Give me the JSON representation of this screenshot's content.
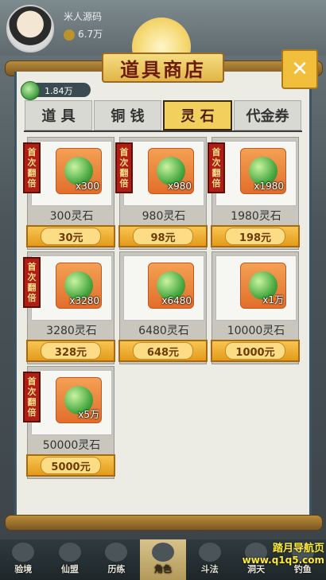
{
  "player": {
    "name": "米人源码",
    "coins": "6.7万"
  },
  "shop": {
    "title": "道具商店",
    "close_symbol": "✕"
  },
  "balance": {
    "gem_icon": "spirit-stone-icon",
    "value": "1.84万"
  },
  "tabs": [
    {
      "label": "道 具",
      "active": false
    },
    {
      "label": "铜 钱",
      "active": false
    },
    {
      "label": "灵 石",
      "active": true
    },
    {
      "label": "代金券",
      "active": false
    }
  ],
  "tag_text": [
    "首",
    "次",
    "翻",
    "倍"
  ],
  "items": [
    {
      "qty": "x300",
      "name": "300灵石",
      "price": "30元"
    },
    {
      "qty": "x980",
      "name": "980灵石",
      "price": "98元"
    },
    {
      "qty": "x1980",
      "name": "1980灵石",
      "price": "198元"
    },
    {
      "qty": "x3280",
      "name": "3280灵石",
      "price": "328元"
    },
    {
      "qty": "x6480",
      "name": "6480灵石",
      "price": "648元"
    },
    {
      "qty": "x1万",
      "name": "10000灵石",
      "price": "1000元"
    },
    {
      "qty": "x5万",
      "name": "50000灵石",
      "price": "5000元"
    }
  ],
  "nav": [
    {
      "label": "验境",
      "active": false
    },
    {
      "label": "仙盟",
      "active": false
    },
    {
      "label": "历练",
      "active": false
    },
    {
      "label": "角色",
      "active": true
    },
    {
      "label": "斗法",
      "active": false
    },
    {
      "label": "洞天",
      "active": false
    },
    {
      "label": "钓鱼",
      "active": false
    }
  ],
  "watermark": {
    "line1": "踏月导航页",
    "line2": "www.q1q5.com"
  },
  "colors": {
    "accent": "#f3cf5e",
    "tag_red": "#b11c14",
    "panel": "#ecebe4"
  }
}
